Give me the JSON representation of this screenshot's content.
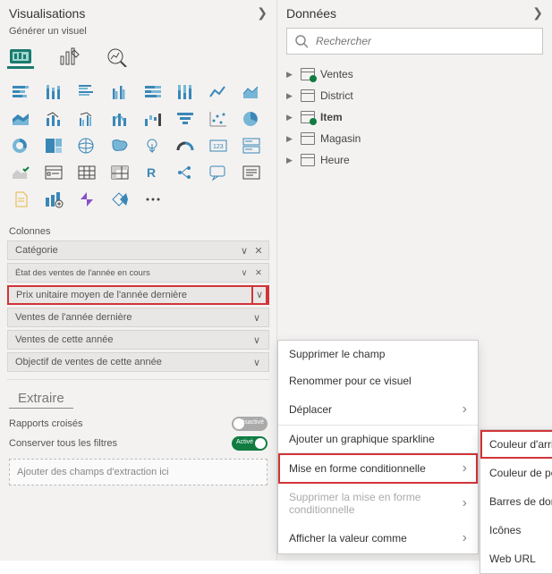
{
  "left": {
    "title": "Visualisations",
    "subtitle": "Générer un visuel",
    "columns_label": "Colonnes",
    "fields": [
      {
        "label": "Catégorie",
        "removable": true
      },
      {
        "label": "État des ventes de l'année en cours",
        "removable": true,
        "small": true
      },
      {
        "label": "Prix unitaire moyen de l'année dernière",
        "removable": false,
        "highlight": true
      },
      {
        "label": "Ventes de l'année dernière",
        "removable": false
      },
      {
        "label": "Ventes de cette année",
        "removable": false
      },
      {
        "label": "Objectif de ventes de cette année",
        "removable": false
      }
    ],
    "extract": {
      "title": "Extraire",
      "cross_report": "Rapports croisés",
      "cross_report_state": "Désactivé",
      "keep_filters": "Conserver tous les filtres",
      "keep_filters_state": "Activé",
      "drill_placeholder": "Ajouter des champs d'extraction ici"
    }
  },
  "right": {
    "title": "Données",
    "search_placeholder": "Rechercher",
    "tables": [
      {
        "name": "Ventes",
        "badge": true
      },
      {
        "name": "District",
        "badge": false
      },
      {
        "name": "Item",
        "badge": true,
        "bold": true
      },
      {
        "name": "Magasin",
        "badge": false
      },
      {
        "name": "Heure",
        "badge": false
      }
    ]
  },
  "menu1": {
    "items": [
      {
        "label": "Supprimer le champ"
      },
      {
        "label": "Renommer pour ce visuel"
      },
      {
        "label": "Déplacer",
        "submenu": true
      },
      {
        "label": "Ajouter un graphique sparkline"
      },
      {
        "label": "Mise en forme conditionnelle",
        "submenu": true,
        "highlight": true
      },
      {
        "label": "Supprimer la mise en forme conditionnelle",
        "submenu": true,
        "disabled": true
      },
      {
        "label": "Afficher la valeur comme",
        "submenu": true
      }
    ]
  },
  "menu2": {
    "items": [
      {
        "label": "Couleur d'arrière-plan",
        "highlight": true
      },
      {
        "label": "Couleur de police"
      },
      {
        "label": "Barres de données"
      },
      {
        "label": "Icônes"
      },
      {
        "label": "Web URL"
      }
    ]
  }
}
